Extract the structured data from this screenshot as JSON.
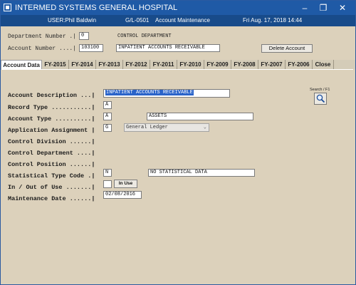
{
  "window": {
    "title": "INTERMED SYSTEMS GENERAL HOSPITAL",
    "buttons": {
      "minimize": "–",
      "restore": "❐",
      "close": "✕"
    }
  },
  "userbar": {
    "user": "USER:Phil Baldwin",
    "screen": "G/L-0501",
    "module": "Account Maintenance",
    "datetime": "Fri Aug. 17, 2018 14:44"
  },
  "header": {
    "dept_label": "Department Number .|",
    "dept_value": "0",
    "dept_desc": "CONTROL DEPARTMENT",
    "acct_label": "Account Number ....|",
    "acct_value": "103100",
    "acct_desc": "INPATIENT ACCOUNTS RECEIVABLE",
    "delete_label": "Delete Account"
  },
  "tabs": [
    "Account Data",
    "FY-2015",
    "FY-2014",
    "FY-2013",
    "FY-2012",
    "FY-2011",
    "FY-2010",
    "FY-2009",
    "FY-2008",
    "FY-2007",
    "FY-2006",
    "Close"
  ],
  "search": {
    "label": "Search / F1"
  },
  "form": {
    "account_description": {
      "label": "Account Description ...|",
      "value": "INPATIENT ACCOUNTS RECEIVABLE"
    },
    "record_type": {
      "label": "Record Type ...........|",
      "value": "A"
    },
    "account_type": {
      "label": "Account Type ..........|",
      "value": "A",
      "desc": "ASSETS"
    },
    "application_assignment": {
      "label": "Application Assignment |",
      "value": "G",
      "select": "General Ledger"
    },
    "control_division": {
      "label": "Control Division ......|"
    },
    "control_department": {
      "label": "Control Department ....|"
    },
    "control_position": {
      "label": "Control Position ......|"
    },
    "statistical_type_code": {
      "label": "Statistical Type Code .|",
      "value": "N",
      "desc": "NO STATISTICAL DATA"
    },
    "in_out_of_use": {
      "label": "In / Out of Use .......|",
      "value": "",
      "button": "In Use"
    },
    "maintenance_date": {
      "label": "Maintenance Date ......|",
      "value": "02/08/2016"
    }
  }
}
